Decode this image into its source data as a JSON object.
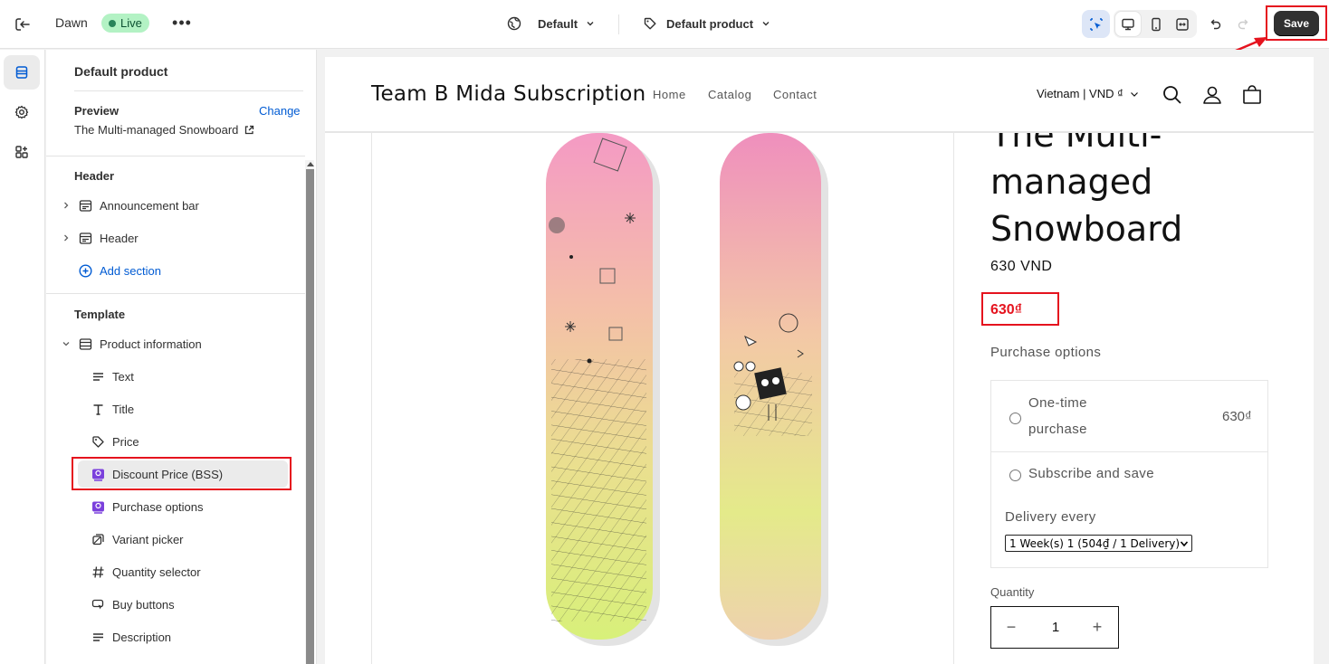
{
  "topbar": {
    "theme_name": "Dawn",
    "live_badge": "Live",
    "more": "•••",
    "template_select": "Default",
    "product_select": "Default product",
    "save_label": "Save"
  },
  "panel": {
    "title": "Default product",
    "preview_label": "Preview",
    "change_link": "Change",
    "preview_product": "The Multi-managed Snowboard",
    "header_section": "Header",
    "header_items": [
      "Announcement bar",
      "Header"
    ],
    "add_section": "Add section",
    "template_section": "Template",
    "product_information": "Product information",
    "blocks": [
      "Text",
      "Title",
      "Price",
      "Discount Price (BSS)",
      "Purchase options",
      "Variant picker",
      "Quantity selector",
      "Buy buttons",
      "Description"
    ]
  },
  "store": {
    "name": "Team B Mida Subscription",
    "nav": [
      "Home",
      "Catalog",
      "Contact"
    ],
    "country": "Vietnam | VND ₫",
    "product_title_line1": "The Multi-",
    "product_title_line2": "managed",
    "product_title_line3": "Snowboard",
    "price": "630 VND",
    "discount_price": "630₫",
    "purchase_options_label": "Purchase options",
    "one_time_line1": "One-time",
    "one_time_line2": "purchase",
    "one_time_price": "630₫",
    "subscribe_label": "Subscribe and save",
    "delivery_label": "Delivery every",
    "delivery_value": "1 Week(s) 1 (504₫ / 1 Delivery)",
    "quantity_label": "Quantity",
    "quantity_value": "1",
    "qty_minus": "−",
    "qty_plus": "+"
  },
  "colors": {
    "accent_red": "#e5131e",
    "link_blue": "#005bd3",
    "live_green": "#b3f2c4",
    "save_bg": "#303030"
  },
  "icons": [
    "exit-icon",
    "globe-icon",
    "tag-icon",
    "inspector-icon",
    "desktop-icon",
    "mobile-icon",
    "fullwidth-icon",
    "undo-icon",
    "redo-icon",
    "sections-icon",
    "settings-icon",
    "apps-icon",
    "search-icon",
    "account-icon",
    "cart-icon"
  ]
}
